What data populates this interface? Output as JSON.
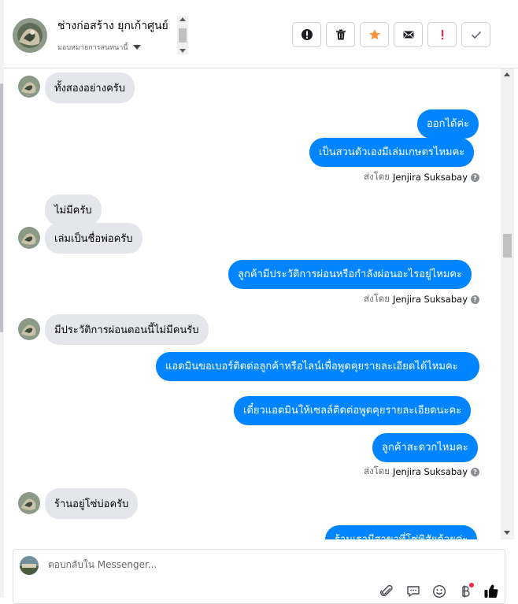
{
  "header": {
    "contact_name": "ช่างก่อสร้าง ยุกเก้าศูนย์",
    "assign_label": "มอบหมายการสนทนานี้",
    "actions": [
      {
        "name": "spam-button",
        "icon": "alert-circle-icon"
      },
      {
        "name": "delete-button",
        "icon": "trash-icon"
      },
      {
        "name": "star-button",
        "icon": "star-icon"
      },
      {
        "name": "mark-unread-button",
        "icon": "envelope-icon"
      },
      {
        "name": "follow-up-button",
        "icon": "exclamation-icon"
      },
      {
        "name": "mark-done-button",
        "icon": "check-icon"
      }
    ]
  },
  "messages": {
    "m1": "ทั้งสองอย่างครับ",
    "m2": "ออกได้ค่ะ",
    "m3": "เป็นสวนตัวเองมีเล่มเกษตรไหมคะ",
    "m4": "ไม่มีครับ",
    "m5": "เล่มเป็นชื่อพ่อครับ",
    "m6": "ลูกค้ามีประวัติการผ่อนหรือกำลังผ่อนอะไรอยู่ไหมคะ",
    "m7": "มีประวัติการผ่อนตอนนี้ไม่มีคนรับ",
    "m8": "แอดมินขอเบอร์ติดต่อลูกค้าหรือไลน์เพื่อพูดคุยรายละเอียดได้ไหมคะ",
    "m9": "เดี๋ยวแอดมินให้เซลล์ติดต่อพูดคุยรายละเอียดนะคะ",
    "m10": "ลูกค้าสะดวกไหมคะ",
    "m11": "ร้านอยู่โซ่บ่อครับ",
    "m12": "ร้านเรามีสาขาที่โซ่พิสัยด้วยค่ะ"
  },
  "sent_by": {
    "prefix": "ส่งโดย",
    "sender": "Jenjira Suksabay",
    "help": "?"
  },
  "composer": {
    "placeholder": "ตอบกลับใน Messenger...",
    "value": ""
  },
  "colors": {
    "outgoing_bubble": "#0084ff",
    "incoming_bubble": "#e4e6eb",
    "star": "#f7923a",
    "flag": "#f02849",
    "like": "#050505"
  }
}
